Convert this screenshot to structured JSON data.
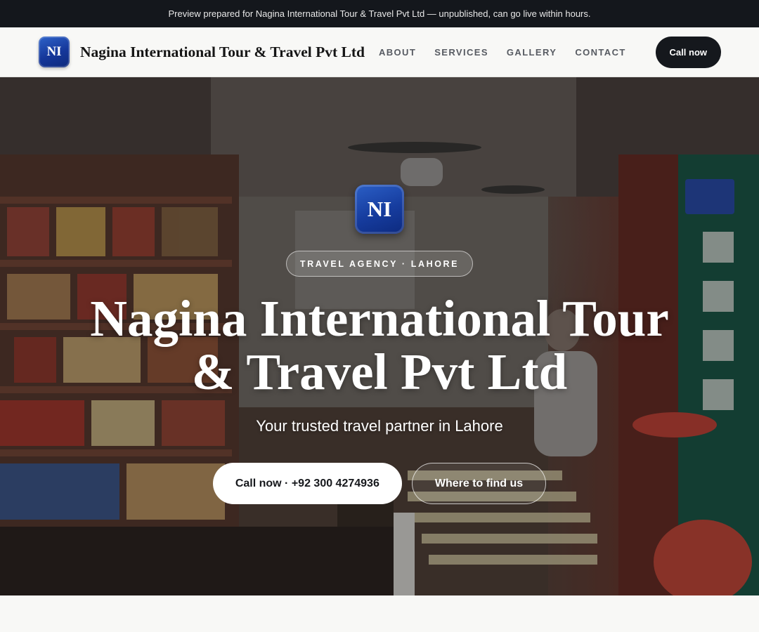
{
  "preview_banner": {
    "text": "Preview prepared for Nagina International Tour & Travel Pvt Ltd — unpublished, can go live within hours."
  },
  "header": {
    "logo_initials": "NI",
    "brand_name": "Nagina International Tour & Travel Pvt Ltd",
    "nav": [
      {
        "label": "ABOUT"
      },
      {
        "label": "SERVICES"
      },
      {
        "label": "GALLERY"
      },
      {
        "label": "CONTACT"
      }
    ],
    "cta_label": "Call now"
  },
  "hero": {
    "logo_initials": "NI",
    "eyebrow": "TRAVEL AGENCY · LAHORE",
    "title": "Nagina International Tour & Travel Pvt Ltd",
    "subtitle": "Your trusted travel partner in Lahore",
    "primary_button": "Call now · +92 300 4274936",
    "secondary_button": "Where to find us",
    "background_image": "photo of a crowded shop interior with shelves and signage"
  },
  "colors": {
    "brand_blue": "#1a45a8",
    "dark": "#15181d",
    "page_bg": "#f8f8f6"
  }
}
